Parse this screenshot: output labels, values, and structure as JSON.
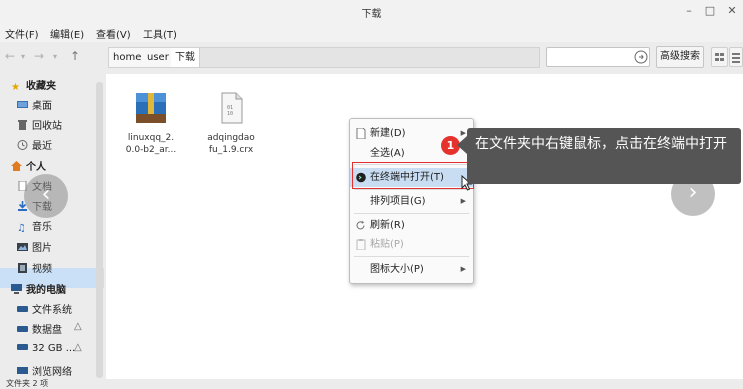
{
  "window": {
    "title": "下载"
  },
  "menubar": {
    "items": [
      "文件(F)",
      "编辑(E)",
      "查看(V)",
      "工具(T)"
    ]
  },
  "breadcrumb": [
    "home",
    "user",
    "下载"
  ],
  "search": {
    "placeholder": "",
    "advanced_label": "高级搜索"
  },
  "sidebar": {
    "favorites_label": "收藏夹",
    "favorites": [
      "桌面",
      "回收站",
      "最近"
    ],
    "personal_label": "个人",
    "personal": [
      "文档",
      "下载",
      "音乐",
      "图片",
      "视频"
    ],
    "computer_label": "我的电脑",
    "computer": [
      "文件系统",
      "数据盘",
      "32 GB ..."
    ],
    "network": "浏览网络"
  },
  "files": [
    {
      "name_line1": "linuxqq_2.",
      "name_line2": "0.0-b2_ar...",
      "icon": "package-icon"
    },
    {
      "name_line1": "adqingdao",
      "name_line2": "fu_1.9.crx",
      "icon": "document-icon"
    }
  ],
  "statusbar": {
    "text": "文件夹 2 项"
  },
  "context_menu": {
    "new": "新建(D)",
    "select_all": "全选(A)",
    "open_terminal": "在终端中打开(T)",
    "sort": "排列项目(G)",
    "refresh": "刷新(R)",
    "paste": "粘贴(P)",
    "icon_size": "图标大小(P)"
  },
  "callout": {
    "step": "1",
    "text": "在文件夹中右键鼠标，点击在终端中打开"
  },
  "colors": {
    "accent": "#c9e0f7",
    "highlight_border": "#e03030",
    "callout_bg": "#555555",
    "step_dot": "#e5322d"
  }
}
